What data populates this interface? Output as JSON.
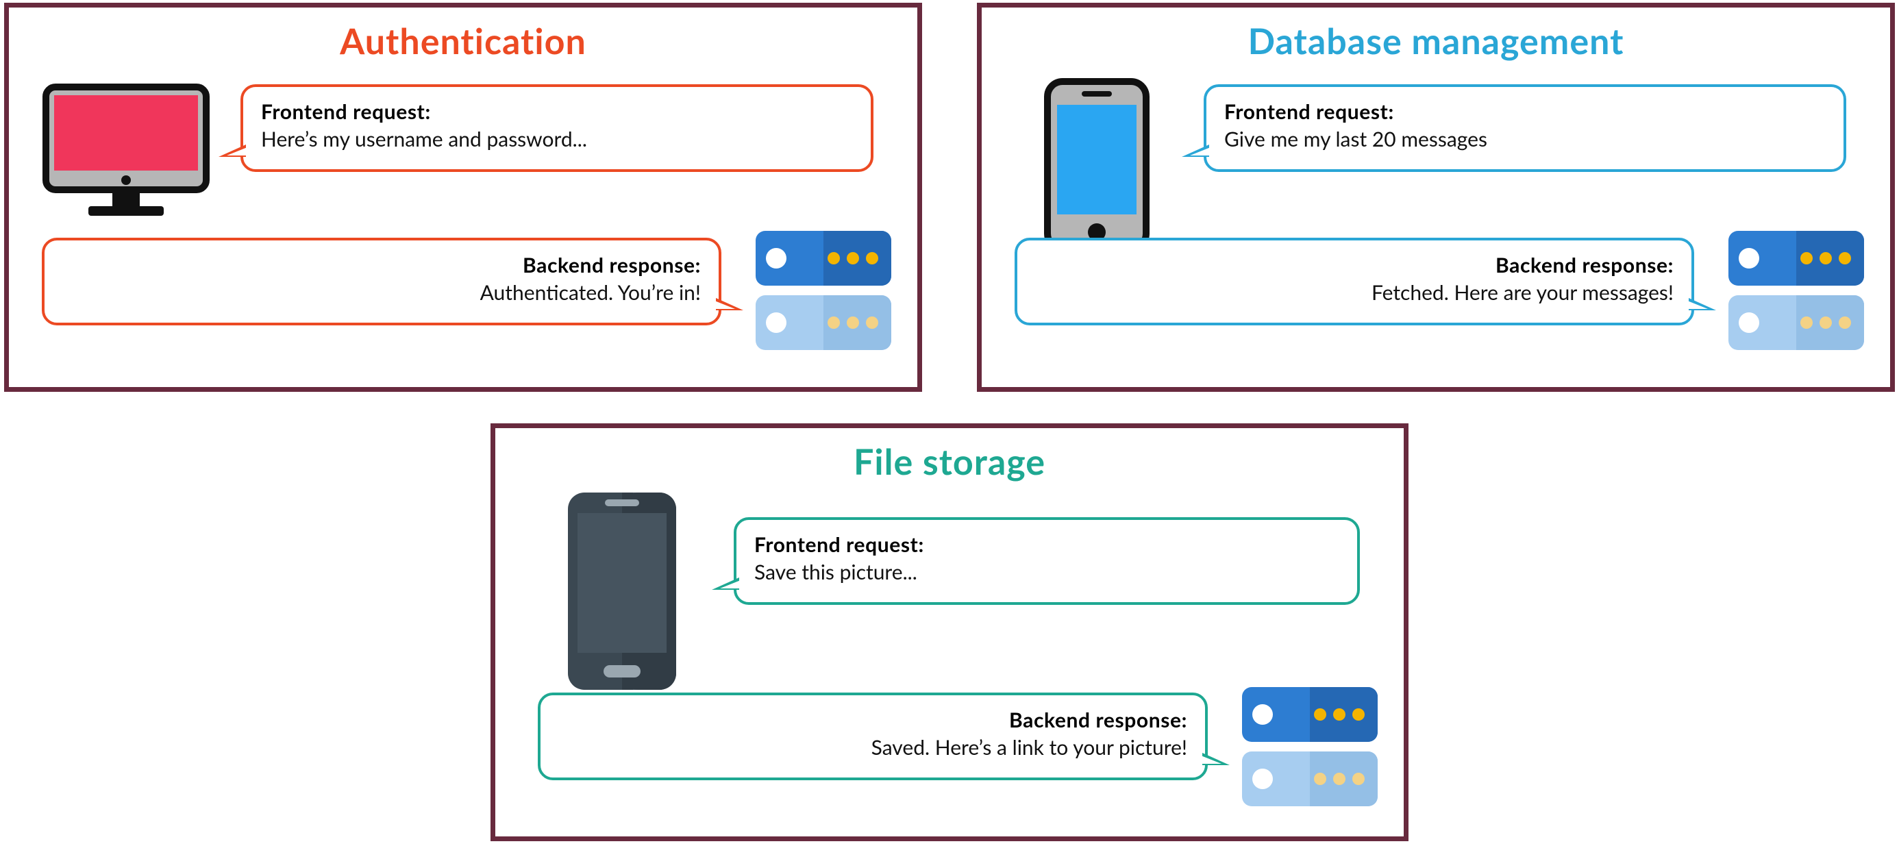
{
  "panels": {
    "auth": {
      "title": "Authentication",
      "color": "#ec4a23",
      "request_label": "Frontend  request:",
      "request_body": "Here’s my username and password...",
      "response_label": "Backend  response:",
      "response_body": "Authenticated. You’re in!"
    },
    "db": {
      "title": "Database  management",
      "color": "#2aa6d6",
      "request_label": "Frontend  request:",
      "request_body": "Give me my last 20 messages",
      "response_label": "Backend  response:",
      "response_body": "Fetched. Here are your messages!"
    },
    "file": {
      "title": "File storage",
      "color": "#1ea892",
      "request_label": "Frontend  request:",
      "request_body": "Save this picture...",
      "response_label": "Backend  response:",
      "response_body": "Saved. Here’s a link to your picture!"
    }
  },
  "icons": {
    "monitor": "monitor-icon",
    "phone_blue": "phone-icon",
    "phone_dark": "phone-icon",
    "server": "server-icon"
  },
  "colors": {
    "panel_border": "#682a3e",
    "server_top": "#2d7dd2",
    "server_bottom": "#a7cdf0",
    "server_led": "#f4b400",
    "monitor_screen": "#f0365b",
    "phone_screen_blue": "#2aa6f2",
    "phone_dark_body": "#3b4852"
  }
}
